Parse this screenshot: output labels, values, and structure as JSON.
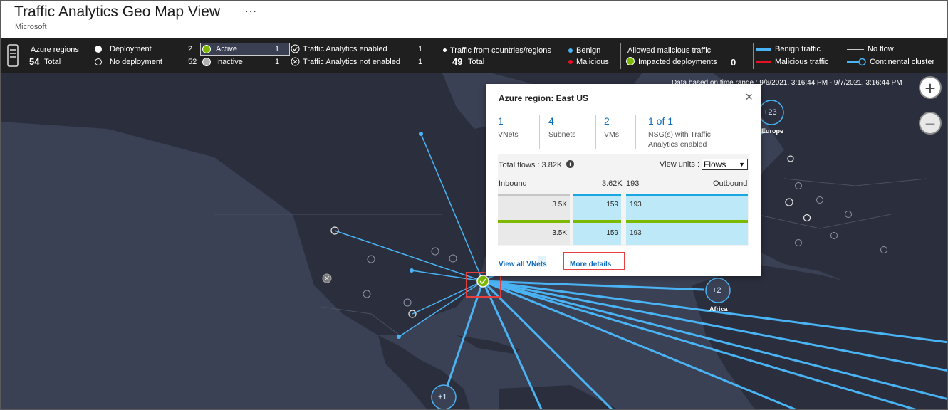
{
  "header": {
    "title": "Traffic Analytics Geo Map View",
    "more": "···",
    "subtitle": "Microsoft"
  },
  "legend": {
    "azure_regions_label": "Azure regions",
    "azure_regions_total_count": "54",
    "azure_regions_total_label": "Total",
    "deployment_label": "Deployment",
    "deployment_count": "2",
    "no_deployment_label": "No deployment",
    "no_deployment_count": "52",
    "active_label": "Active",
    "active_count": "1",
    "inactive_label": "Inactive",
    "inactive_count": "1",
    "ta_enabled_label": "Traffic Analytics enabled",
    "ta_enabled_count": "1",
    "ta_not_enabled_label": "Traffic Analytics not enabled",
    "ta_not_enabled_count": "1",
    "countries_label": "Traffic from countries/regions",
    "countries_count": "49",
    "countries_total_label": "Total",
    "benign_label": "Benign",
    "malicious_label": "Malicious",
    "allowed_malicious_label": "Allowed malicious traffic",
    "impacted_label": "Impacted deployments",
    "impacted_count": "0",
    "benign_traffic_label": "Benign traffic",
    "malicious_traffic_label": "Malicious traffic",
    "no_flow_label": "No flow",
    "continental_cluster_label": "Continental cluster",
    "colors": {
      "benign": "#4ab3f4",
      "malicious": "#e81123",
      "active": "#7db900",
      "no_flow": "#c8c8c8"
    }
  },
  "map": {
    "time_range": "Data based on time range : 9/6/2021, 3:16:44 PM - 9/7/2021, 3:16:44 PM",
    "zoom_in": "+",
    "zoom_out": "−",
    "clusters": {
      "europe_count": "+23",
      "europe_label": "Europe",
      "africa_count": "+2",
      "africa_label": "Africa",
      "south_count": "+1"
    }
  },
  "popup": {
    "title": "Azure region: East US",
    "close": "×",
    "stats": [
      {
        "value": "1",
        "label": "VNets"
      },
      {
        "value": "4",
        "label": "Subnets"
      },
      {
        "value": "2",
        "label": "VMs"
      },
      {
        "value": "1 of 1",
        "label": "NSG(s) with Traffic Analytics enabled"
      }
    ],
    "total_flows": "Total flows : 3.82K",
    "info_icon": "i",
    "view_units_label": "View units :",
    "view_units_value": "Flows",
    "inbound_label": "Inbound",
    "inbound_total": "3.62K",
    "outbound_total": "193",
    "outbound_label": "Outbound",
    "rows": [
      {
        "c1": "3.5K",
        "c2": "159",
        "c3": "193"
      },
      {
        "c1": "3.5K",
        "c2": "159",
        "c3": "193"
      }
    ],
    "view_all_vnets": "View all VNets",
    "more_details": "More details"
  }
}
